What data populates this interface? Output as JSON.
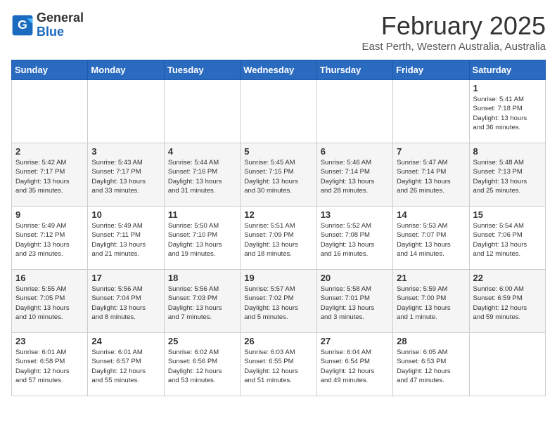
{
  "logo": {
    "line1": "General",
    "line2": "Blue"
  },
  "title": "February 2025",
  "subtitle": "East Perth, Western Australia, Australia",
  "weekdays": [
    "Sunday",
    "Monday",
    "Tuesday",
    "Wednesday",
    "Thursday",
    "Friday",
    "Saturday"
  ],
  "weeks": [
    [
      {
        "day": "",
        "info": ""
      },
      {
        "day": "",
        "info": ""
      },
      {
        "day": "",
        "info": ""
      },
      {
        "day": "",
        "info": ""
      },
      {
        "day": "",
        "info": ""
      },
      {
        "day": "",
        "info": ""
      },
      {
        "day": "1",
        "info": "Sunrise: 5:41 AM\nSunset: 7:18 PM\nDaylight: 13 hours\nand 36 minutes."
      }
    ],
    [
      {
        "day": "2",
        "info": "Sunrise: 5:42 AM\nSunset: 7:17 PM\nDaylight: 13 hours\nand 35 minutes."
      },
      {
        "day": "3",
        "info": "Sunrise: 5:43 AM\nSunset: 7:17 PM\nDaylight: 13 hours\nand 33 minutes."
      },
      {
        "day": "4",
        "info": "Sunrise: 5:44 AM\nSunset: 7:16 PM\nDaylight: 13 hours\nand 31 minutes."
      },
      {
        "day": "5",
        "info": "Sunrise: 5:45 AM\nSunset: 7:15 PM\nDaylight: 13 hours\nand 30 minutes."
      },
      {
        "day": "6",
        "info": "Sunrise: 5:46 AM\nSunset: 7:14 PM\nDaylight: 13 hours\nand 28 minutes."
      },
      {
        "day": "7",
        "info": "Sunrise: 5:47 AM\nSunset: 7:14 PM\nDaylight: 13 hours\nand 26 minutes."
      },
      {
        "day": "8",
        "info": "Sunrise: 5:48 AM\nSunset: 7:13 PM\nDaylight: 13 hours\nand 25 minutes."
      }
    ],
    [
      {
        "day": "9",
        "info": "Sunrise: 5:49 AM\nSunset: 7:12 PM\nDaylight: 13 hours\nand 23 minutes."
      },
      {
        "day": "10",
        "info": "Sunrise: 5:49 AM\nSunset: 7:11 PM\nDaylight: 13 hours\nand 21 minutes."
      },
      {
        "day": "11",
        "info": "Sunrise: 5:50 AM\nSunset: 7:10 PM\nDaylight: 13 hours\nand 19 minutes."
      },
      {
        "day": "12",
        "info": "Sunrise: 5:51 AM\nSunset: 7:09 PM\nDaylight: 13 hours\nand 18 minutes."
      },
      {
        "day": "13",
        "info": "Sunrise: 5:52 AM\nSunset: 7:08 PM\nDaylight: 13 hours\nand 16 minutes."
      },
      {
        "day": "14",
        "info": "Sunrise: 5:53 AM\nSunset: 7:07 PM\nDaylight: 13 hours\nand 14 minutes."
      },
      {
        "day": "15",
        "info": "Sunrise: 5:54 AM\nSunset: 7:06 PM\nDaylight: 13 hours\nand 12 minutes."
      }
    ],
    [
      {
        "day": "16",
        "info": "Sunrise: 5:55 AM\nSunset: 7:05 PM\nDaylight: 13 hours\nand 10 minutes."
      },
      {
        "day": "17",
        "info": "Sunrise: 5:56 AM\nSunset: 7:04 PM\nDaylight: 13 hours\nand 8 minutes."
      },
      {
        "day": "18",
        "info": "Sunrise: 5:56 AM\nSunset: 7:03 PM\nDaylight: 13 hours\nand 7 minutes."
      },
      {
        "day": "19",
        "info": "Sunrise: 5:57 AM\nSunset: 7:02 PM\nDaylight: 13 hours\nand 5 minutes."
      },
      {
        "day": "20",
        "info": "Sunrise: 5:58 AM\nSunset: 7:01 PM\nDaylight: 13 hours\nand 3 minutes."
      },
      {
        "day": "21",
        "info": "Sunrise: 5:59 AM\nSunset: 7:00 PM\nDaylight: 13 hours\nand 1 minute."
      },
      {
        "day": "22",
        "info": "Sunrise: 6:00 AM\nSunset: 6:59 PM\nDaylight: 12 hours\nand 59 minutes."
      }
    ],
    [
      {
        "day": "23",
        "info": "Sunrise: 6:01 AM\nSunset: 6:58 PM\nDaylight: 12 hours\nand 57 minutes."
      },
      {
        "day": "24",
        "info": "Sunrise: 6:01 AM\nSunset: 6:57 PM\nDaylight: 12 hours\nand 55 minutes."
      },
      {
        "day": "25",
        "info": "Sunrise: 6:02 AM\nSunset: 6:56 PM\nDaylight: 12 hours\nand 53 minutes."
      },
      {
        "day": "26",
        "info": "Sunrise: 6:03 AM\nSunset: 6:55 PM\nDaylight: 12 hours\nand 51 minutes."
      },
      {
        "day": "27",
        "info": "Sunrise: 6:04 AM\nSunset: 6:54 PM\nDaylight: 12 hours\nand 49 minutes."
      },
      {
        "day": "28",
        "info": "Sunrise: 6:05 AM\nSunset: 6:53 PM\nDaylight: 12 hours\nand 47 minutes."
      },
      {
        "day": "",
        "info": ""
      }
    ]
  ]
}
